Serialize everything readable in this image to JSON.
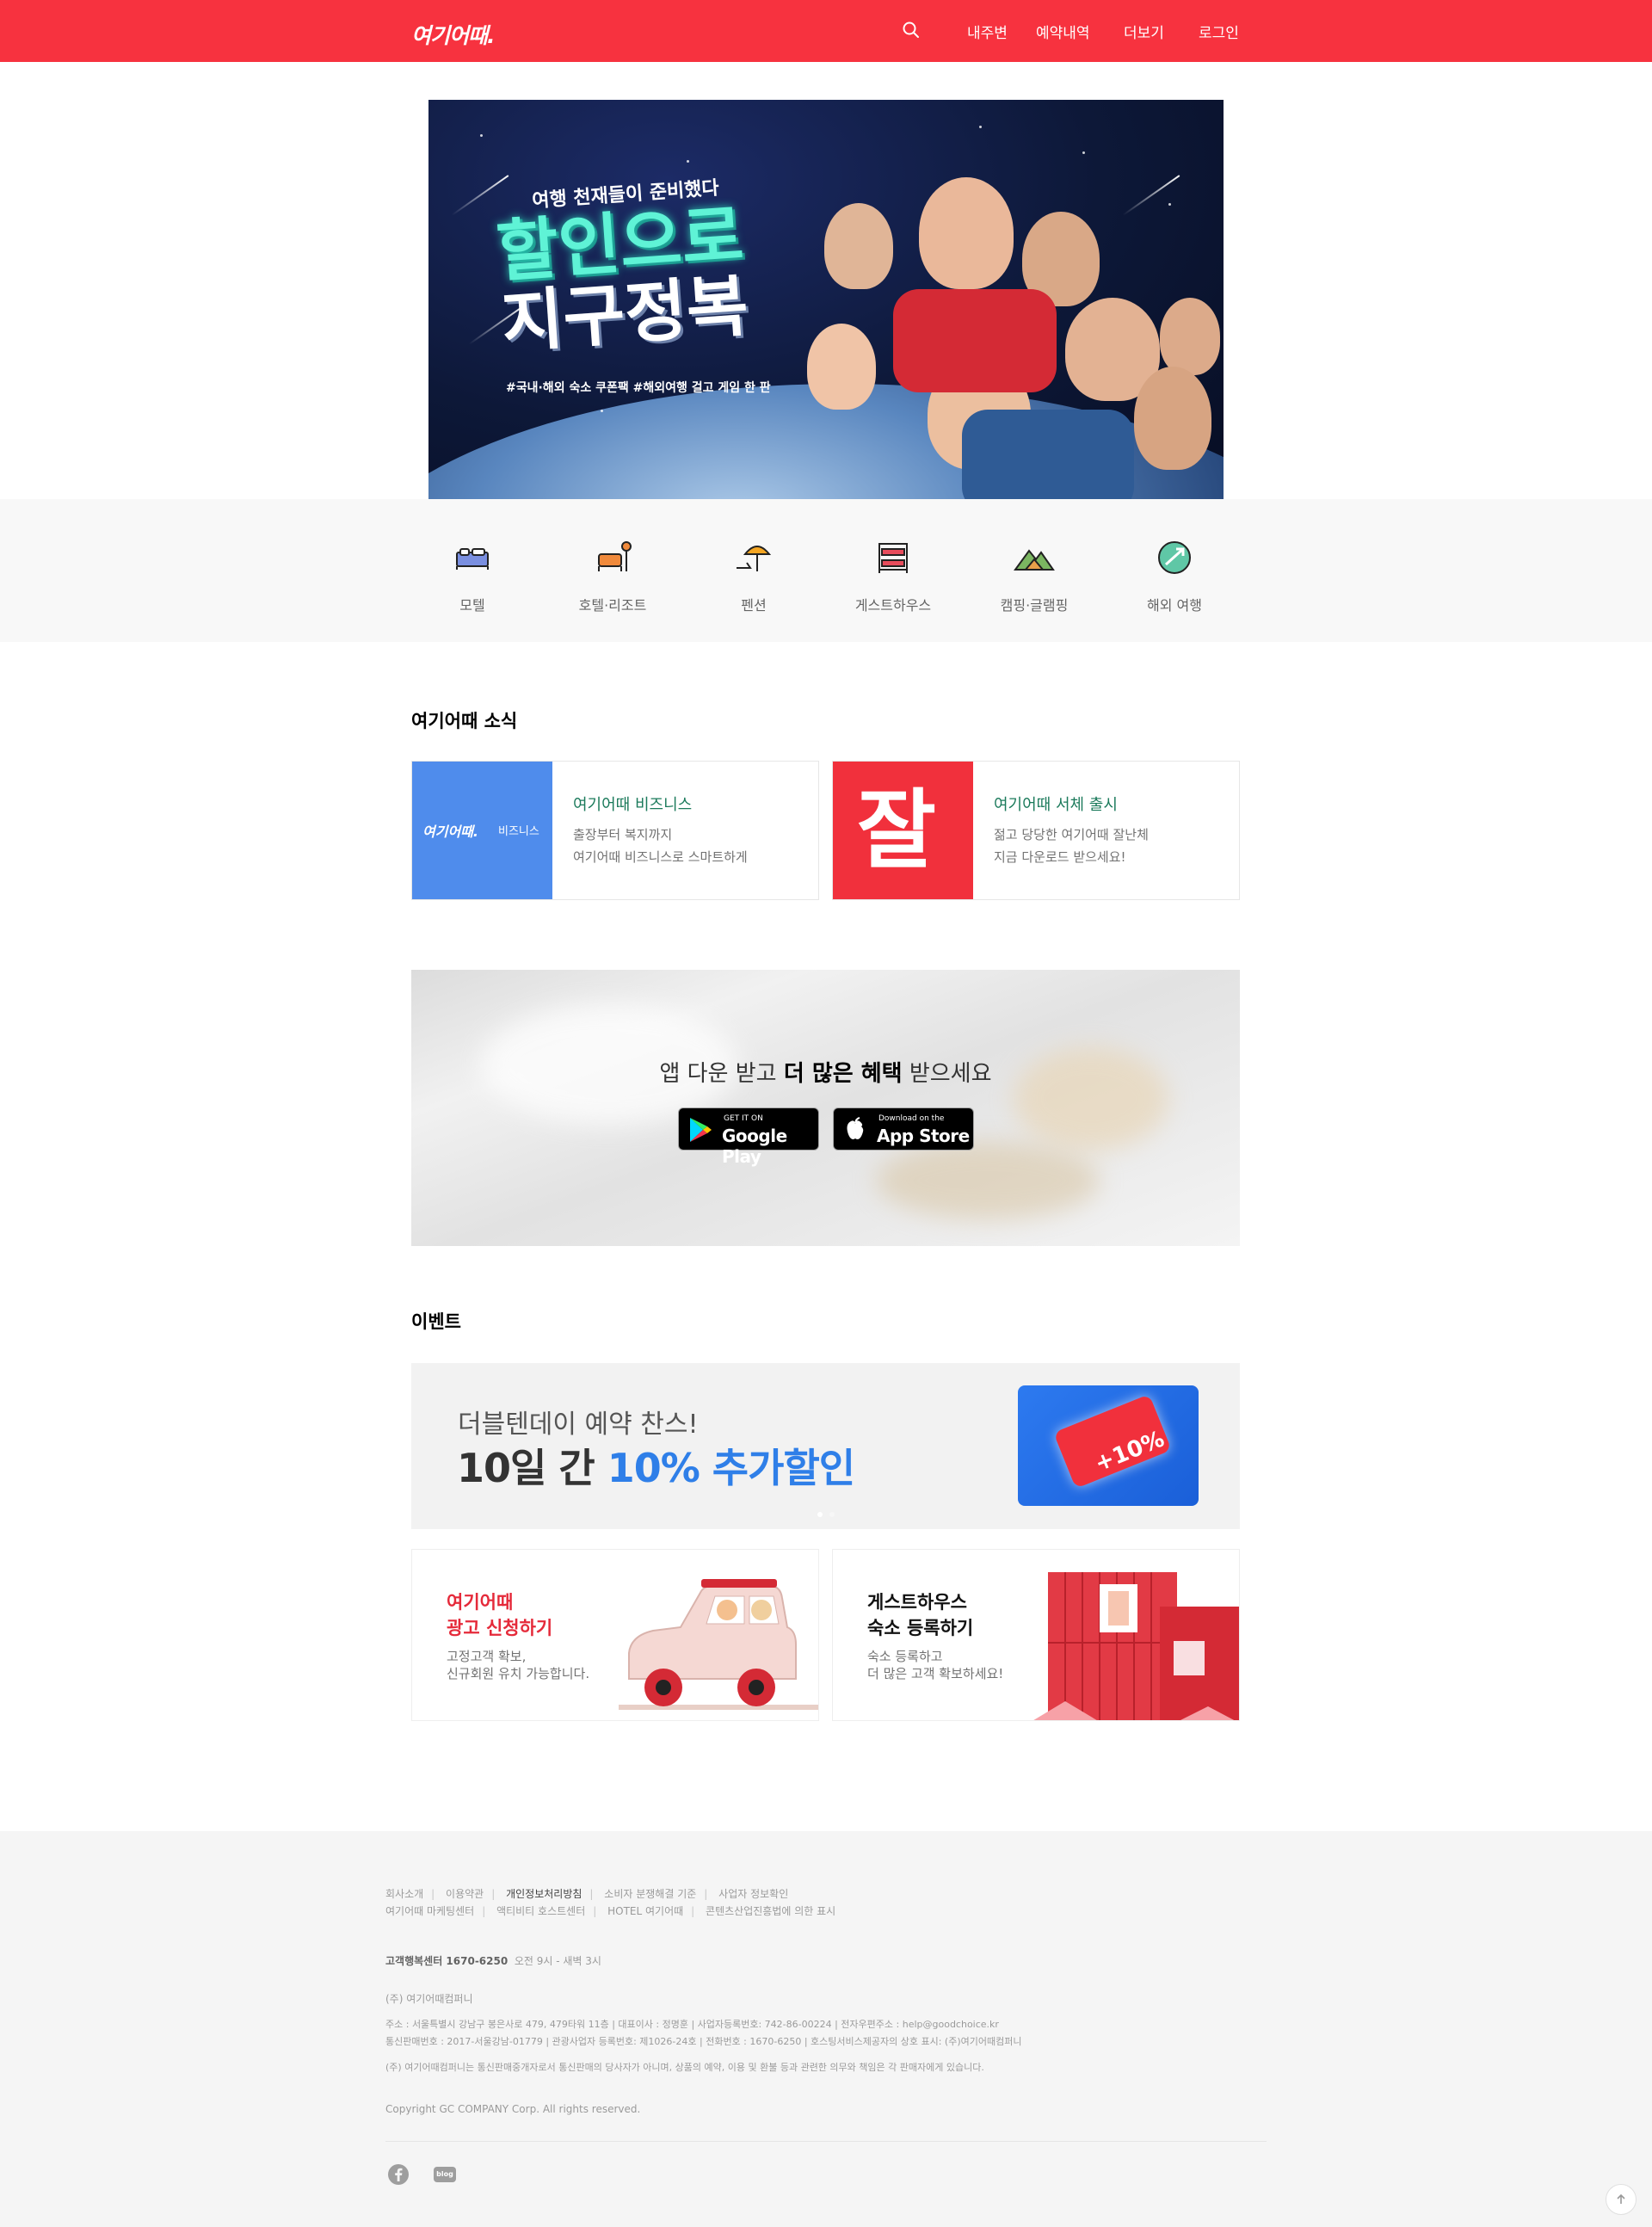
{
  "header": {
    "logo": "여기어때.",
    "nav": [
      {
        "label": "내주변"
      },
      {
        "label": "예약내역"
      },
      {
        "label": "더보기"
      },
      {
        "label": "로그인"
      }
    ],
    "brand_color": "#f7323f"
  },
  "hero": {
    "eyebrow": "여행 천재들이 준비했다",
    "headline_line1": "할인으로",
    "headline_line2": "지구정복",
    "tags": "#국내·해외 숙소 쿠폰팩  #해외여행 걸고 게임 한 판"
  },
  "categories": [
    {
      "label": "모텔",
      "icon": "bed-icon"
    },
    {
      "label": "호텔·리조트",
      "icon": "lounge-chair-icon"
    },
    {
      "label": "펜션",
      "icon": "parasol-icon"
    },
    {
      "label": "게스트하우스",
      "icon": "bunk-bed-icon"
    },
    {
      "label": "캠핑·글램핑",
      "icon": "mountain-icon"
    },
    {
      "label": "해외 여행",
      "icon": "globe-plane-icon"
    }
  ],
  "news": {
    "title": "여기어때 소식",
    "items": [
      {
        "title": "여기어때 비즈니스",
        "line1": "출장부터 복지까지",
        "line2": "여기어때 비즈니스로 스마트하게",
        "thumb_logo": "여기어때.",
        "thumb_sub": "비즈니스"
      },
      {
        "title": "여기어때 서체 출시",
        "line1": "젊고 당당한 여기어때 잘난체",
        "line2": "지금 다운로드 받으세요!",
        "thumb_char": "잘"
      }
    ]
  },
  "app_banner": {
    "msg_pre": "앱 다운 받고 ",
    "msg_bold": "더 많은 혜택",
    "msg_post": " 받으세요",
    "google": {
      "small": "GET IT ON",
      "big": "Google Play"
    },
    "apple": {
      "small": "Download on the",
      "big": "App Store"
    }
  },
  "events": {
    "title": "이벤트",
    "banner": {
      "sub": "더블텐데이 예약 찬스!",
      "main_pre": "10일 간 ",
      "main_hl": "10% 추가할인",
      "badge": "+10%"
    },
    "cards": [
      {
        "line1": "여기어때",
        "line2": "광고 신청하기",
        "desc1": "고정고객 확보,",
        "desc2": "신규회원 유치 가능합니다."
      },
      {
        "line1": "게스트하우스",
        "line2": "숙소 등록하기",
        "desc1": "숙소 등록하고",
        "desc2": "더 많은 고객 확보하세요!"
      }
    ]
  },
  "footer": {
    "links_row1": [
      "회사소개",
      "이용약관",
      "개인정보처리방침",
      "소비자 분쟁해결 기준",
      "사업자 정보확인"
    ],
    "links_row2": [
      "여기어때 마케팅센터",
      "액티비티 호스트센터",
      "HOTEL 여기어때",
      "콘텐츠산업진흥법에 의한 표시"
    ],
    "cs_label": "고객행복센터 1670-6250",
    "cs_hours": "오전 9시 - 새벽 3시",
    "company": "(주) 여기어때컴퍼니",
    "addr1": "주소 : 서울특별시 강남구 봉은사로 479, 479타워 11층 | 대표이사 : 정명훈 | 사업자등록번호: 742-86-00224 | 전자우편주소 : help@goodchoice.kr",
    "addr2": "통신판매번호 : 2017-서울강남-01779 | 관광사업자 등록번호: 제1026-24호 | 전화번호 : 1670-6250 | 호스팅서비스제공자의 상호 표시: (주)여기어때컴퍼니",
    "notice": "(주) 여기어때컴퍼니는 통신판매중개자로서 통신판매의 당사자가 아니며, 상품의 예약, 이용 및 환불 등과 관련한 의무와 책임은 각 판매자에게 있습니다.",
    "copyright": "Copyright GC COMPANY Corp. All rights reserved.",
    "blog_label": "blog"
  }
}
